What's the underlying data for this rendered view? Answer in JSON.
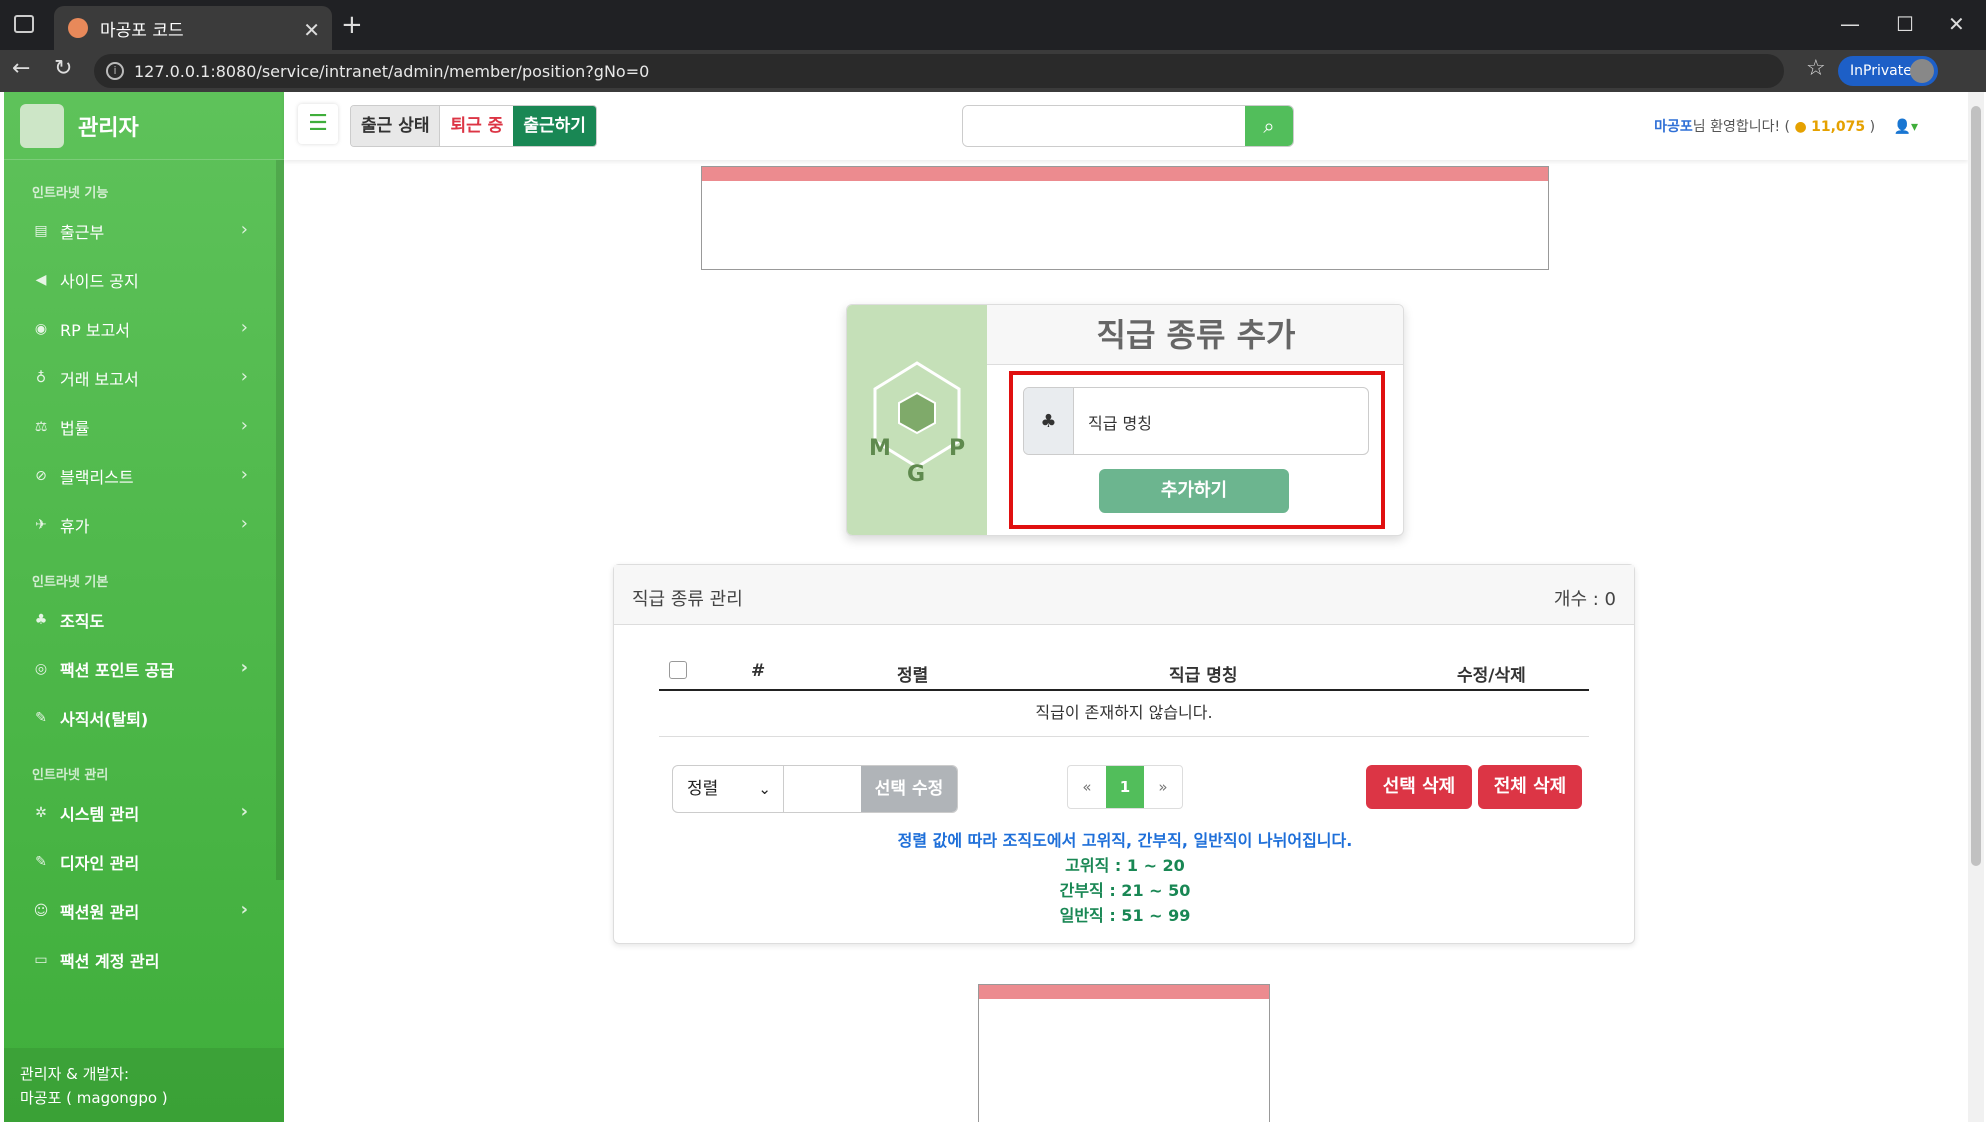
{
  "browser": {
    "tab_title": "마공포 코드",
    "url": "127.0.0.1:8080/service/intranet/admin/member/position?gNo=0",
    "inprivate": "InPrivate"
  },
  "sidebar": {
    "brand": "관리자",
    "section1": "인트라넷 기능",
    "items1": [
      {
        "label": "출근부",
        "icon": "book-icon",
        "chev": true
      },
      {
        "label": "사이드 공지",
        "icon": "megaphone-icon",
        "chev": false
      },
      {
        "label": "RP 보고서",
        "icon": "gamepad-icon",
        "chev": true
      },
      {
        "label": "거래 보고서",
        "icon": "moneybag-icon",
        "chev": true
      },
      {
        "label": "법률",
        "icon": "scale-icon",
        "chev": true
      },
      {
        "label": "블랙리스트",
        "icon": "ban-icon",
        "chev": true
      },
      {
        "label": "휴가",
        "icon": "plane-icon",
        "chev": true
      }
    ],
    "section2": "인트라넷 기본",
    "items2": [
      {
        "label": "조직도",
        "icon": "sitemap-icon",
        "chev": false
      },
      {
        "label": "팩션 포인트 공급",
        "icon": "coins-icon",
        "chev": true
      },
      {
        "label": "사직서(탈퇴)",
        "icon": "pen-icon",
        "chev": false
      }
    ],
    "section3": "인트라넷 관리",
    "items3": [
      {
        "label": "시스템 관리",
        "icon": "gear-icon",
        "chev": true
      },
      {
        "label": "디자인 관리",
        "icon": "brush-icon",
        "chev": false
      },
      {
        "label": "팩션원 관리",
        "icon": "user-gear-icon",
        "chev": true
      },
      {
        "label": "팩션 계정 관리",
        "icon": "id-card-icon",
        "chev": false
      }
    ],
    "footer_line1": "관리자 & 개발자:",
    "footer_line2": "마공포 ( magongpo )"
  },
  "topbar": {
    "status_label": "출근 상태",
    "status_value": "퇴근 중",
    "checkin_button": "출근하기",
    "search_placeholder": "",
    "welcome_name": "마공포",
    "welcome_text": "님 환영합니다! (",
    "points": "11,075",
    "welcome_close": ")"
  },
  "add_card": {
    "title": "직급 종류 추가",
    "input_placeholder": "직급 명칭",
    "add_button": "추가하기"
  },
  "manage_card": {
    "title": "직급 종류 관리",
    "count_label": "개수 : 0",
    "columns": [
      "#",
      "정렬",
      "직급 명칭",
      "수정/삭제"
    ],
    "empty_message": "직급이 존재하지 않습니다.",
    "sort_select": "정렬",
    "edit_selected": "선택 수정",
    "pager": [
      "«",
      "1",
      "»"
    ],
    "delete_selected": "선택 삭제",
    "delete_all": "전체 삭제",
    "note_main": "정렬 값에 따라 조직도에서 고위직, 간부직, 일반직이 나뉘어집니다.",
    "note_high": "고위직 : 1 ~ 20",
    "note_mid": "간부직 : 21 ~ 50",
    "note_low": "일반직 : 51 ~ 99"
  },
  "colors": {
    "sidebar": "#4cb848",
    "accent": "#52be5b",
    "danger": "#dc3545",
    "highlight": "#e01010"
  }
}
